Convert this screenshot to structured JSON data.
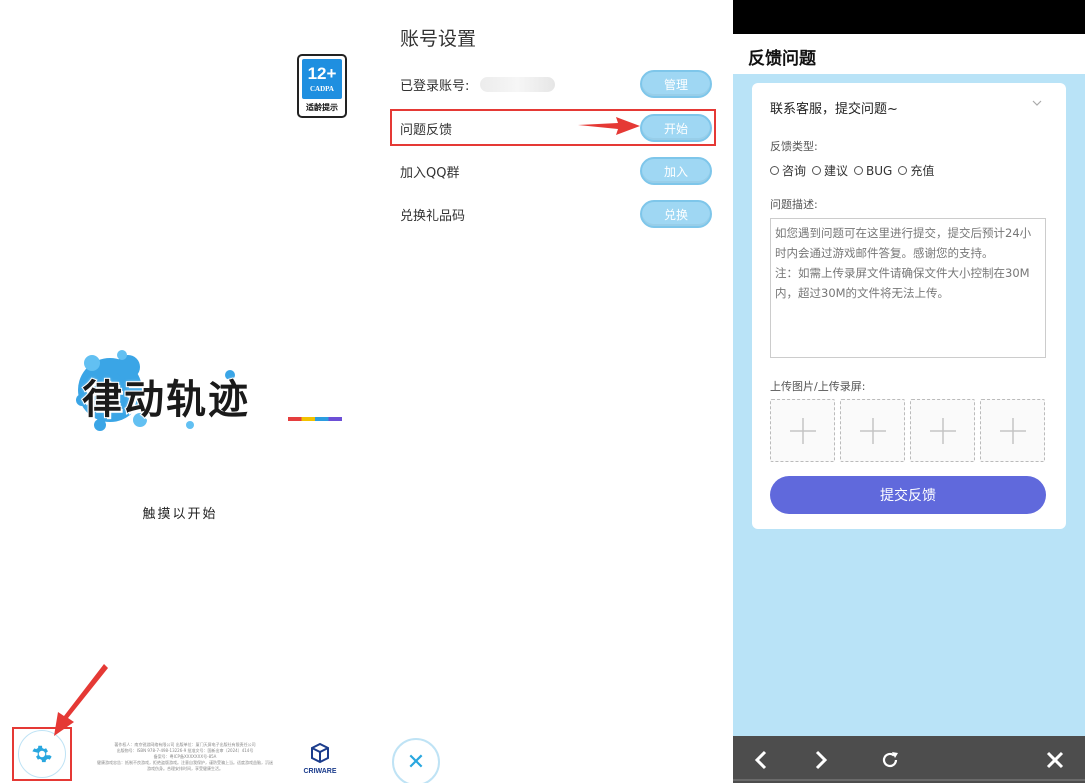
{
  "title_screen": {
    "age_rating": {
      "number": "12+",
      "org": "CADPA",
      "tip": "适龄提示"
    },
    "logo_text": "律动轨迹",
    "touch_to_start": "触摸以开始",
    "fineprint_lines": [
      "著作权人：南京锐游网络有限公司 出版单位：厦门天屏电子出版社有限责任公司",
      "出版物号：ISBN 978-7-498-13226-9 批准文号：国新出审〔2024〕414号",
      "备案号：粤ICP备XXXXXXX号-85A",
      "健康游戏忠告：抵制不良游戏，拒绝盗版游戏。注意自我保护，谨防受骗上当。适度游戏益脑，沉迷游戏伤身。合理安排时间，享受健康生活。"
    ],
    "criware_label": "CRIWARE"
  },
  "account_settings": {
    "title": "账号设置",
    "rows": [
      {
        "label": "已登录账号:",
        "button": "管理"
      },
      {
        "label": "问题反馈",
        "button": "开始"
      },
      {
        "label": "加入QQ群",
        "button": "加入"
      },
      {
        "label": "兑换礼品码",
        "button": "兑换"
      }
    ],
    "close_glyph": "✕"
  },
  "feedback": {
    "header_title": "反馈问题",
    "contact": "联系客服，提交问题~",
    "type_label": "反馈类型:",
    "types": [
      "咨询",
      "建议",
      "BUG",
      "充值"
    ],
    "desc_label": "问题描述:",
    "desc_placeholder": "如您遇到问题可在这里进行提交，提交后预计24小时内会通过游戏邮件答复。感谢您的支持。\n注：如需上传录屏文件请确保文件大小控制在30M内，超过30M的文件将无法上传。",
    "upload_label": "上传图片/上传录屏:",
    "submit": "提交反馈"
  },
  "colors": {
    "accent_blue": "#9fd7f3",
    "highlight_red": "#e53935",
    "submit_purple": "#6069dc",
    "webview_bg": "#b9e3f7"
  },
  "icons": {
    "settings": "gear-icon",
    "close": "close-icon",
    "back": "chevron-left-icon",
    "forward": "chevron-right-icon",
    "reload": "reload-icon",
    "exit": "close-icon",
    "add": "plus-icon",
    "dropdown": "chevron-down-icon"
  }
}
